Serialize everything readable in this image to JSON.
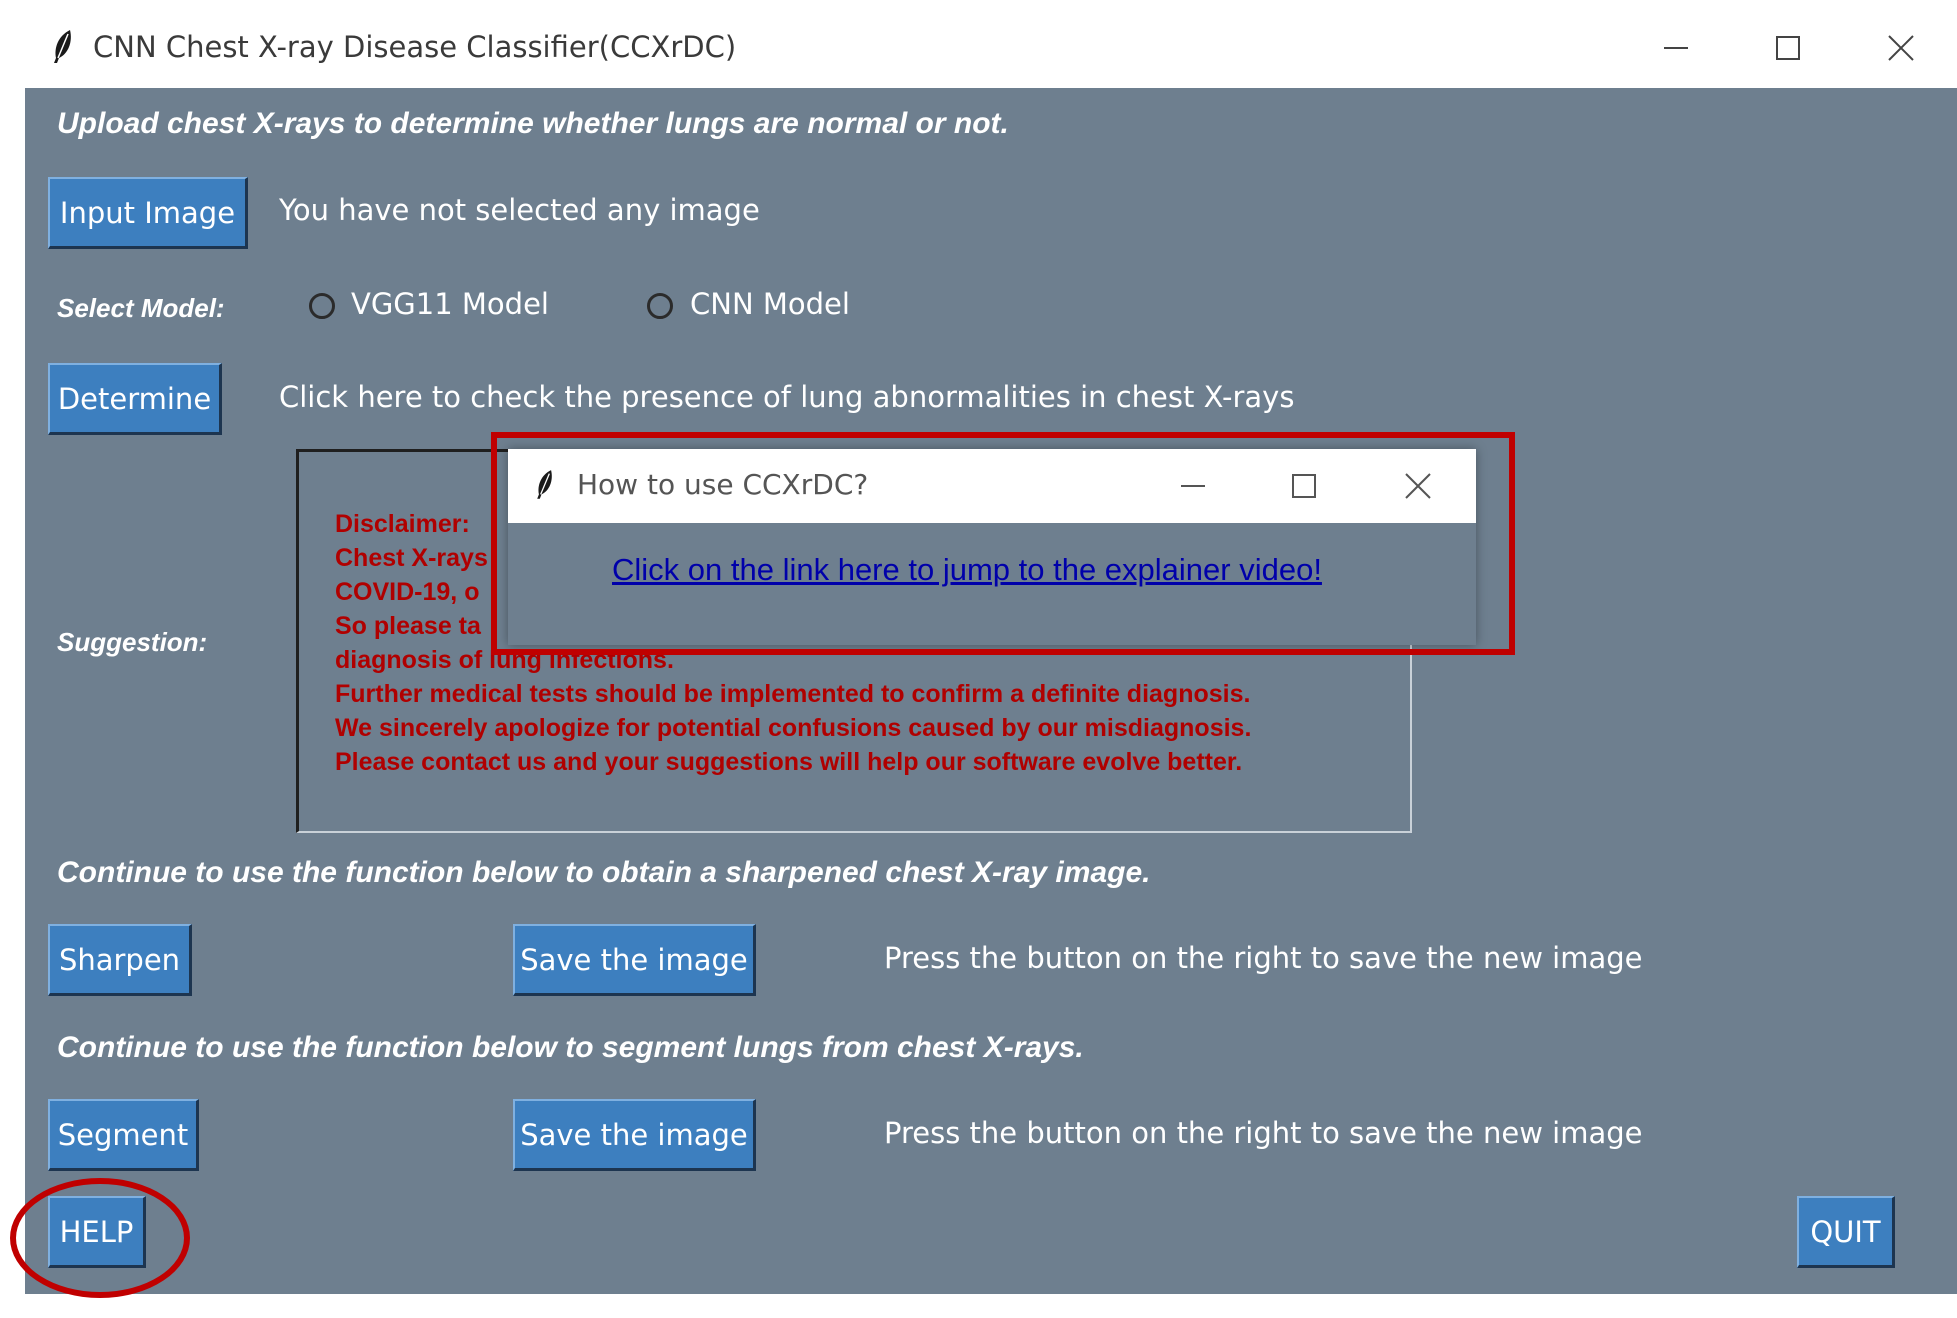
{
  "window": {
    "title": "CNN Chest X-ray Disease Classifier(CCXrDC)"
  },
  "header_text": "Upload chest X-rays to determine whether lungs are normal or not.",
  "input": {
    "button_label": "Input Image",
    "status": "You have not selected any image"
  },
  "model": {
    "label": "Select Model:",
    "options": [
      "VGG11 Model",
      "CNN Model"
    ]
  },
  "determine": {
    "button_label": "Determine",
    "description": "Click here to check the presence of lung abnormalities in chest X-rays"
  },
  "suggestion": {
    "label": "Suggestion:",
    "lines": [
      "Disclaimer:",
      "Chest X-rays",
      "COVID-19, o",
      "So please ta",
      "diagnosis of lung infections.",
      "Further medical tests should be implemented to confirm a definite diagnosis.",
      "We sincerely apologize for potential confusions caused by our misdiagnosis.",
      "Please contact us and your suggestions will help our software evolve better."
    ]
  },
  "sharpen_section": {
    "heading": "Continue to use the function below to obtain a sharpened chest X-ray image.",
    "button_label": "Sharpen",
    "save_label": "Save the image",
    "hint": "Press the button on the right to save the new image"
  },
  "segment_section": {
    "heading": "Continue to use the function below to segment lungs from chest X-rays.",
    "button_label": "Segment",
    "save_label": "Save the image",
    "hint": "Press the button on the right to save the new image"
  },
  "help_label": "HELP",
  "quit_label": "QUIT",
  "popup": {
    "title": "How to use CCXrDC?",
    "link_text": "Click on the link here to jump to the explainer video!"
  },
  "colors": {
    "background": "#6e7f8f",
    "button": "#3d7fbf",
    "disclaimer_text": "#b00000",
    "link": "#0000aa",
    "highlight": "#c00000"
  }
}
